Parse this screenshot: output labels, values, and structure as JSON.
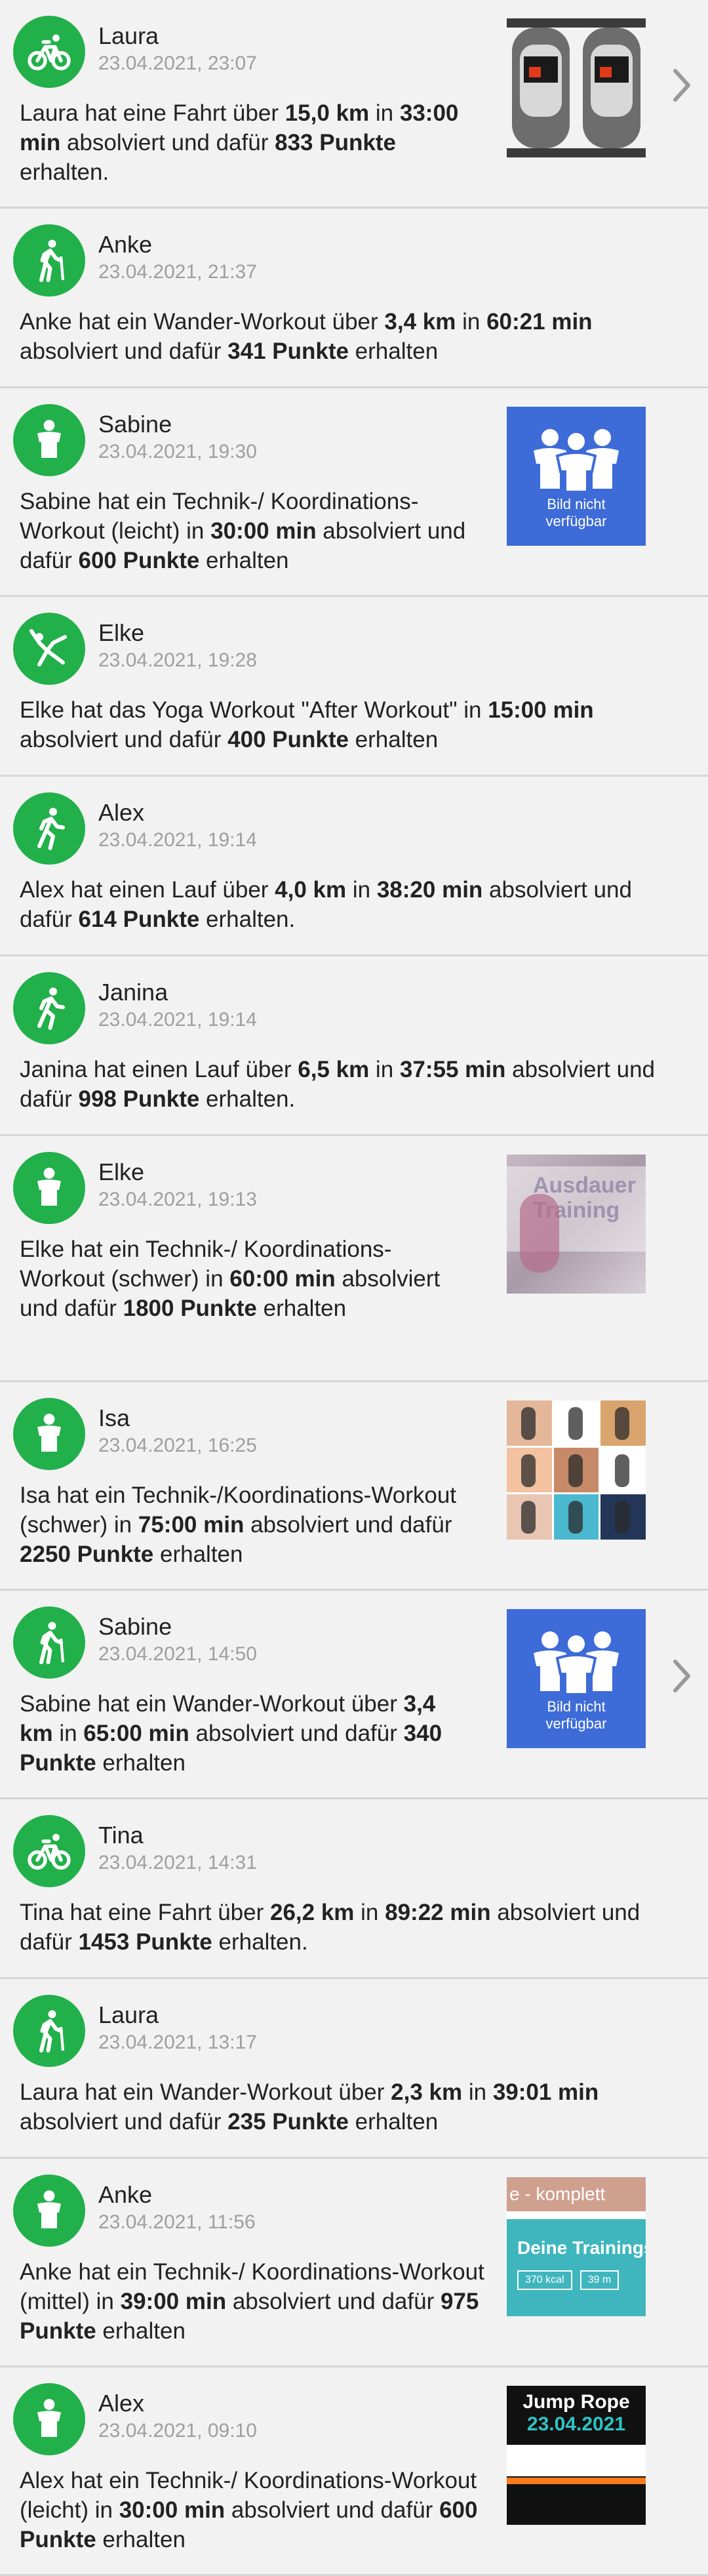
{
  "colors": {
    "avatar": "#22b04b",
    "placeholder": "#3d6bd8",
    "background": "#f1f1f1",
    "divider": "#d6d6d6"
  },
  "placeholder": {
    "line1": "Bild nicht",
    "line2": "verfügbar"
  },
  "thumbnails": {
    "t12": {
      "top": "e - komplett",
      "title": "Deine Trainingsw",
      "kcal": "370 kcal",
      "min": "39 m"
    },
    "t13": {
      "title": "Jump Rope",
      "date": "23.04.2021"
    },
    "t7": {
      "text": "Ausdauer Training"
    }
  },
  "feed": [
    {
      "name": "Laura",
      "time": "23.04.2021, 23:07",
      "icon": "bike-icon",
      "desc": [
        [
          "Laura  hat eine Fahrt über ",
          0
        ],
        [
          "15,0 km",
          1
        ],
        [
          " in ",
          0
        ],
        [
          "33:00 min",
          1
        ],
        [
          " absolviert und dafür ",
          0
        ],
        [
          "833 Punkte",
          1
        ],
        [
          " erhalten.",
          0
        ]
      ]
    },
    {
      "name": "Anke",
      "time": "23.04.2021, 21:37",
      "icon": "hiking-icon",
      "desc": [
        [
          "Anke hat ein Wander-Workout über ",
          0
        ],
        [
          "3,4 km",
          1
        ],
        [
          " in ",
          0
        ],
        [
          "60:21 min",
          1
        ],
        [
          " absolviert und dafür ",
          0
        ],
        [
          "341 Punkte",
          1
        ],
        [
          " erhalten",
          0
        ]
      ]
    },
    {
      "name": "Sabine",
      "time": "23.04.2021, 19:30",
      "icon": "person-icon",
      "desc": [
        [
          "Sabine hat ein Technik-/ Koordinations-Workout (leicht)  in ",
          0
        ],
        [
          "30:00 min",
          1
        ],
        [
          " absolviert und dafür ",
          0
        ],
        [
          "600 Punkte",
          1
        ],
        [
          " erhalten",
          0
        ]
      ]
    },
    {
      "name": "Elke",
      "time": "23.04.2021, 19:28",
      "icon": "yoga-icon",
      "desc": [
        [
          "Elke  hat das Yoga Workout \"After Workout\" in ",
          0
        ],
        [
          "15:00 min",
          1
        ],
        [
          " absolviert und dafür ",
          0
        ],
        [
          "400 Punkte",
          1
        ],
        [
          " erhalten",
          0
        ]
      ]
    },
    {
      "name": "Alex",
      "time": "23.04.2021, 19:14",
      "icon": "running-icon",
      "desc": [
        [
          "Alex  hat einen Lauf über ",
          0
        ],
        [
          "4,0 km",
          1
        ],
        [
          " in ",
          0
        ],
        [
          "38:20 min",
          1
        ],
        [
          " absolviert und dafür ",
          0
        ],
        [
          "614 Punkte",
          1
        ],
        [
          " erhalten.",
          0
        ]
      ]
    },
    {
      "name": "Janina",
      "time": "23.04.2021, 19:14",
      "icon": "running-icon",
      "desc": [
        [
          "Janina hat einen Lauf über ",
          0
        ],
        [
          "6,5 km",
          1
        ],
        [
          " in ",
          0
        ],
        [
          "37:55 min",
          1
        ],
        [
          " absolviert und dafür ",
          0
        ],
        [
          "998 Punkte",
          1
        ],
        [
          " erhalten.",
          0
        ]
      ]
    },
    {
      "name": "Elke",
      "time": "23.04.2021, 19:13",
      "icon": "person-icon",
      "desc": [
        [
          "Elke  hat ein Technik-/ Koordinations-Workout (schwer)  in ",
          0
        ],
        [
          "60:00 min",
          1
        ],
        [
          " absolviert und dafür ",
          0
        ],
        [
          "1800 Punkte",
          1
        ],
        [
          " erhalten",
          0
        ]
      ]
    },
    {
      "name": "Isa",
      "time": "23.04.2021, 16:25",
      "icon": "person-icon",
      "desc": [
        [
          "Isa hat ein Technik-/Koordinations-Workout (schwer)  in ",
          0
        ],
        [
          "75:00 min",
          1
        ],
        [
          " absolviert und dafür ",
          0
        ],
        [
          "2250 Punkte",
          1
        ],
        [
          " erhalten",
          0
        ]
      ]
    },
    {
      "name": "Sabine",
      "time": "23.04.2021, 14:50",
      "icon": "hiking-icon",
      "desc": [
        [
          "Sabine hat ein Wander-Workout über ",
          0
        ],
        [
          "3,4 km",
          1
        ],
        [
          " in ",
          0
        ],
        [
          "65:00 min",
          1
        ],
        [
          " absolviert und dafür ",
          0
        ],
        [
          "340 Punkte",
          1
        ],
        [
          " erhalten",
          0
        ]
      ]
    },
    {
      "name": "Tina",
      "time": "23.04.2021, 14:31",
      "icon": "bike-icon",
      "desc": [
        [
          "Tina hat eine Fahrt über ",
          0
        ],
        [
          "26,2 km",
          1
        ],
        [
          " in ",
          0
        ],
        [
          "89:22 min",
          1
        ],
        [
          " absolviert und dafür ",
          0
        ],
        [
          "1453 Punkte",
          1
        ],
        [
          " erhalten.",
          0
        ]
      ]
    },
    {
      "name": "Laura",
      "time": "23.04.2021, 13:17",
      "icon": "hiking-icon",
      "desc": [
        [
          "Laura  hat ein Wander-Workout über ",
          0
        ],
        [
          "2,3 km",
          1
        ],
        [
          " in ",
          0
        ],
        [
          "39:01 min",
          1
        ],
        [
          " absolviert und dafür ",
          0
        ],
        [
          "235 Punkte",
          1
        ],
        [
          " erhalten",
          0
        ]
      ]
    },
    {
      "name": "Anke",
      "time": "23.04.2021, 11:56",
      "icon": "person-icon",
      "desc": [
        [
          "Anke hat ein Technik-/ Koordinations-Workout (mittel)  in ",
          0
        ],
        [
          "39:00 min",
          1
        ],
        [
          " absolviert und dafür ",
          0
        ],
        [
          "975 Punkte",
          1
        ],
        [
          " erhalten",
          0
        ]
      ]
    },
    {
      "name": "Alex",
      "time": "23.04.2021, 09:10",
      "icon": "person-icon",
      "desc": [
        [
          "Alex  hat ein Technik-/ Koordinations-Workout (leicht)  in ",
          0
        ],
        [
          "30:00 min",
          1
        ],
        [
          " absolviert und dafür ",
          0
        ],
        [
          "600 Punkte",
          1
        ],
        [
          " erhalten",
          0
        ]
      ]
    }
  ]
}
